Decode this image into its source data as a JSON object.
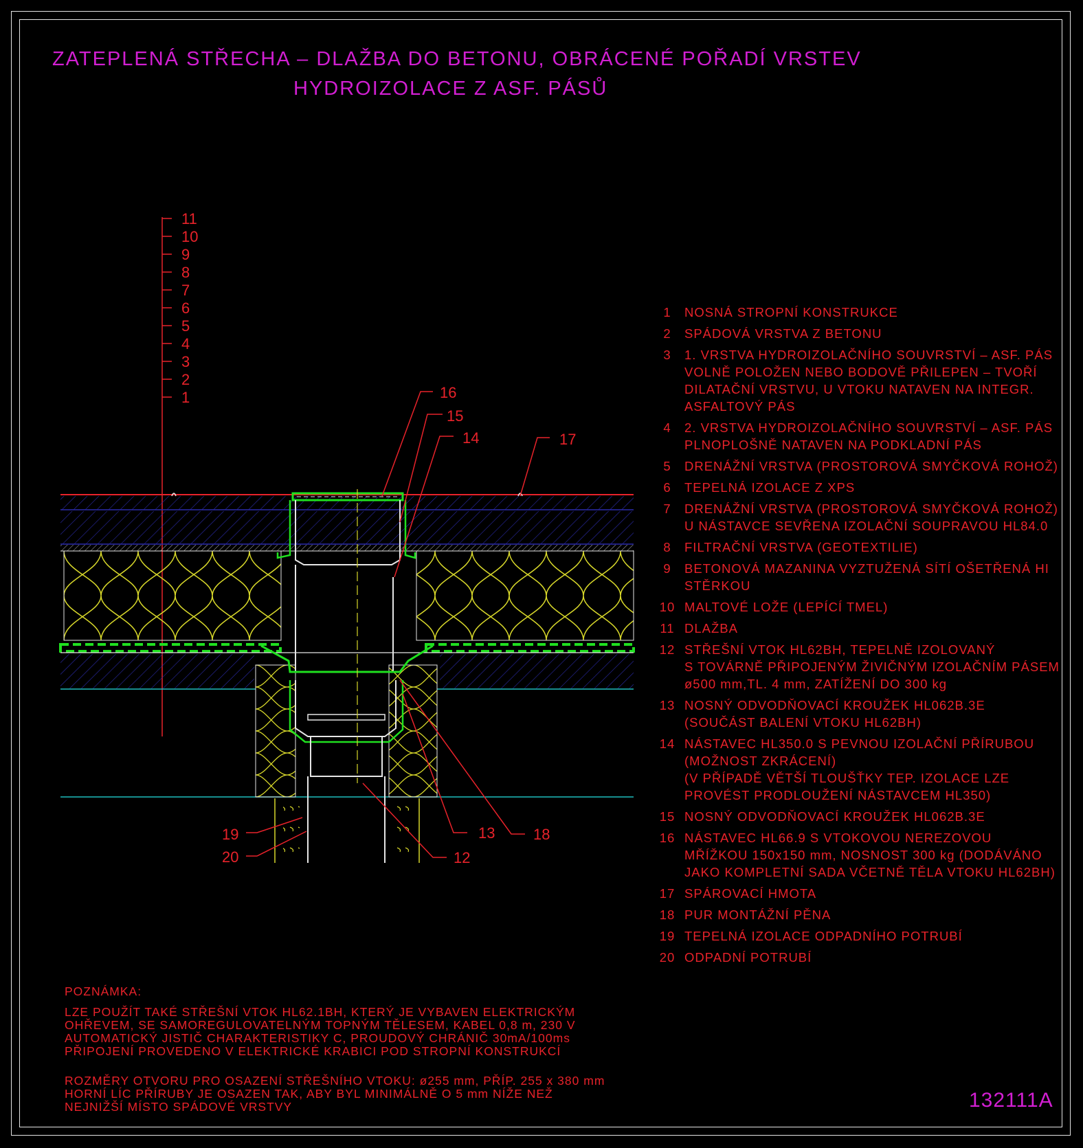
{
  "title": {
    "line1": "ZATEPLENÁ STŘECHA – DLAŽBA DO BETONU, OBRÁCENÉ POŘADÍ VRSTEV",
    "line2": "HYDROIZOLACE Z ASF. PÁSŮ"
  },
  "layer_scale": [
    "11",
    "10",
    "9",
    "8",
    "7",
    "6",
    "5",
    "4",
    "3",
    "2",
    "1"
  ],
  "callouts": {
    "c16": "16",
    "c15": "15",
    "c14": "14",
    "c17": "17",
    "c13": "13",
    "c18": "18",
    "c19": "19",
    "c20": "20",
    "c12": "12"
  },
  "legend": [
    {
      "num": "1",
      "text": "NOSNÁ STROPNÍ KONSTRUKCE"
    },
    {
      "num": "2",
      "text": "SPÁDOVÁ VRSTVA Z BETONU"
    },
    {
      "num": "3",
      "text": "1. VRSTVA HYDROIZOLAČNÍHO SOUVRSTVÍ – ASF. PÁS\nVOLNĚ POLOŽEN NEBO BODOVĚ PŘILEPEN – TVOŘÍ\nDILATAČNÍ VRSTVU, U VTOKU NATAVEN NA INTEGR.\nASFALTOVÝ PÁS"
    },
    {
      "num": "4",
      "text": "2. VRSTVA HYDROIZOLAČNÍHO SOUVRSTVÍ – ASF. PÁS\nPLNOPLOŠNĚ NATAVEN NA PODKLADNÍ PÁS"
    },
    {
      "num": "5",
      "text": "DRENÁŽNÍ VRSTVA (PROSTOROVÁ SMYČKOVÁ ROHOŽ)"
    },
    {
      "num": "6",
      "text": "TEPELNÁ IZOLACE Z XPS"
    },
    {
      "num": "7",
      "text": "DRENÁŽNÍ VRSTVA (PROSTOROVÁ SMYČKOVÁ ROHOŽ)\nU NÁSTAVCE SEVŘENA IZOLAČNÍ SOUPRAVOU HL84.0"
    },
    {
      "num": "8",
      "text": "FILTRAČNÍ VRSTVA (GEOTEXTILIE)"
    },
    {
      "num": "9",
      "text": "BETONOVÁ MAZANINA VYZTUŽENÁ SÍTÍ OŠETŘENÁ HI STĚRKOU"
    },
    {
      "num": "10",
      "text": "MALTOVÉ LOŽE (LEPÍCÍ TMEL)"
    },
    {
      "num": "11",
      "text": "DLAŽBA"
    },
    {
      "num": "12",
      "text": "STŘEŠNÍ VTOK HL62BH, TEPELNĚ IZOLOVANÝ\nS TOVÁRNĚ PŘIPOJENÝM ŽIVIČNÝM IZOLAČNÍM PÁSEM\nø500 mm,TL. 4 mm, ZATÍŽENÍ DO 300 kg"
    },
    {
      "num": "13",
      "text": "NOSNÝ ODVODŇOVACÍ KROUŽEK HL062B.3E\n(SOUČÁST BALENÍ VTOKU HL62BH)"
    },
    {
      "num": "14",
      "text": "NÁSTAVEC HL350.0 S PEVNOU IZOLAČNÍ PŘÍRUBOU\n(MOŽNOST ZKRÁCENÍ)\n(V PŘÍPADĚ VĚTŠÍ TLOUŠŤKY TEP. IZOLACE LZE\nPROVÉST PRODLOUŽENÍ NÁSTAVCEM HL350)"
    },
    {
      "num": "15",
      "text": "NOSNÝ ODVODŇOVACÍ KROUŽEK HL062B.3E"
    },
    {
      "num": "16",
      "text": "NÁSTAVEC HL66.9 S VTOKOVOU NEREZOVOU\nMŘÍŽKOU 150x150 mm, NOSNOST 300 kg (DODÁVÁNO\nJAKO KOMPLETNÍ SADA VČETNĚ TĚLA VTOKU HL62BH)"
    },
    {
      "num": "17",
      "text": "SPÁROVACÍ HMOTA"
    },
    {
      "num": "18",
      "text": "PUR MONTÁŽNÍ PĚNA"
    },
    {
      "num": "19",
      "text": "TEPELNÁ IZOLACE ODPADNÍHO POTRUBÍ"
    },
    {
      "num": "20",
      "text": "ODPADNÍ POTRUBÍ"
    }
  ],
  "note": {
    "heading": "POZNÁMKA:",
    "p1": "LZE POUŽÍT TAKÉ STŘEŠNÍ VTOK HL62.1BH, KTERÝ JE VYBAVEN ELEKTRICKÝM\nOHŘEVEM, SE SAMOREGULOVATELNÝM TOPNÝM TĚLESEM, KABEL 0,8 m, 230 V\nAUTOMATICKÝ JISTIČ CHARAKTERISTIKY C, PROUDOVÝ CHRÁNIČ 30mA/100ms\nPŘIPOJENÍ PROVEDENO V ELEKTRICKÉ KRABICI POD STROPNÍ KONSTRUKCÍ",
    "p2": "ROZMĚRY OTVORU PRO OSAZENÍ STŘEŠNÍHO VTOKU: ø255 mm, PŘÍP. 255 x 380 mm\nHORNÍ LÍC PŘÍRUBY JE OSAZEN TAK, ABY BYL MINIMÁLNĚ O 5 mm NÍŽE NEŽ\nNEJNIŽŠÍ MÍSTO SPÁDOVÉ VRSTVY"
  },
  "drawing_code": "132111A",
  "colors": {
    "title": "#d21fd2",
    "text": "#e8222a",
    "frame": "#e6e6e6",
    "layer_blue": "#2a2aaa",
    "insulation": "#d8d82a",
    "membrane": "#1fe01f",
    "pipe": "#e6e6e6",
    "base_line": "#1fbdbd"
  }
}
